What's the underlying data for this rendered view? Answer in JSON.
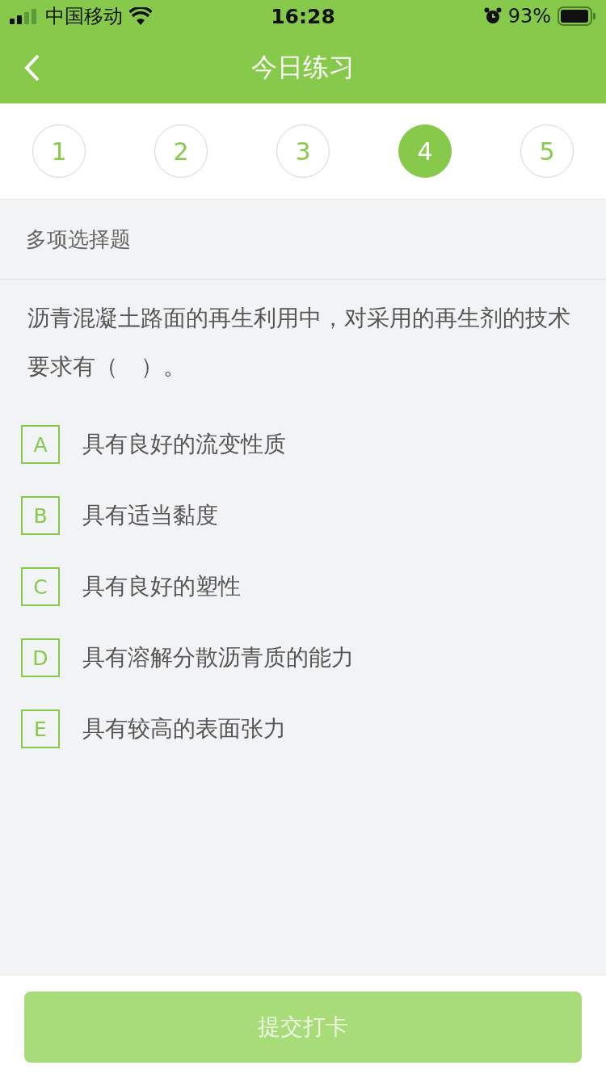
{
  "status_bar": {
    "carrier": "中国移动",
    "time": "16:28",
    "battery": "93%"
  },
  "nav": {
    "title": "今日练习"
  },
  "steps": [
    {
      "label": "1",
      "selected": false
    },
    {
      "label": "2",
      "selected": false
    },
    {
      "label": "3",
      "selected": false
    },
    {
      "label": "4",
      "selected": true
    },
    {
      "label": "5",
      "selected": false
    }
  ],
  "question_type": "多项选择题",
  "question": "沥青混凝土路面的再生利用中，对采用的再生剂的技术要求有（　）。",
  "options": [
    {
      "letter": "A",
      "text": "具有良好的流变性质",
      "selected": false
    },
    {
      "letter": "B",
      "text": "具有适当黏度",
      "selected": false
    },
    {
      "letter": "C",
      "text": "具有良好的塑性",
      "selected": false
    },
    {
      "letter": "D",
      "text": "具有溶解分散沥青质的能力",
      "selected": false
    },
    {
      "letter": "E",
      "text": "具有较高的表面张力",
      "selected": false
    }
  ],
  "submit": {
    "label": "提交打卡",
    "disabled": true
  }
}
